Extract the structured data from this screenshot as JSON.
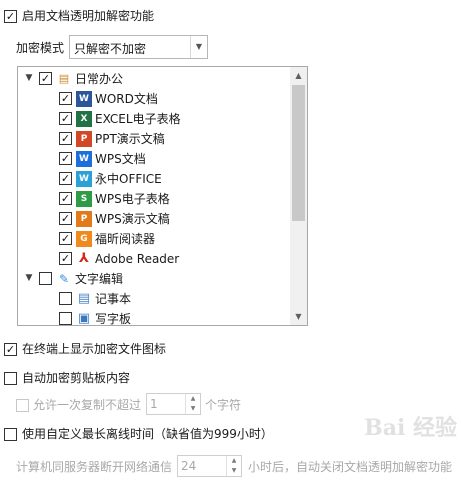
{
  "enable_transparent": {
    "label": "启用文档透明加解密功能",
    "checked": true
  },
  "mode": {
    "label": "加密模式",
    "value": "只解密不加密"
  },
  "tree": {
    "groups": [
      {
        "label": "日常办公",
        "checked": true,
        "expanded": true,
        "items": [
          {
            "label": "WORD文档",
            "checked": true,
            "icon": "word-icon",
            "color": "#2b579a",
            "glyph": "W"
          },
          {
            "label": "EXCEL电子表格",
            "checked": true,
            "icon": "excel-icon",
            "color": "#217346",
            "glyph": "X"
          },
          {
            "label": "PPT演示文稿",
            "checked": true,
            "icon": "ppt-icon",
            "color": "#d24726",
            "glyph": "P"
          },
          {
            "label": "WPS文档",
            "checked": true,
            "icon": "wps-writer-icon",
            "color": "#1e6fd9",
            "glyph": "W"
          },
          {
            "label": "永中OFFICE",
            "checked": true,
            "icon": "yozo-office-icon",
            "color": "#2aa2d8",
            "glyph": "W"
          },
          {
            "label": "WPS电子表格",
            "checked": true,
            "icon": "wps-spreadsheet-icon",
            "color": "#2e9b46",
            "glyph": "S"
          },
          {
            "label": "WPS演示文稿",
            "checked": true,
            "icon": "wps-presentation-icon",
            "color": "#e07a1a",
            "glyph": "P"
          },
          {
            "label": "福昕阅读器",
            "checked": true,
            "icon": "foxit-reader-icon",
            "color": "#f08a1c",
            "glyph": "G"
          },
          {
            "label": "Adobe Reader",
            "checked": true,
            "icon": "adobe-reader-icon",
            "color": "#d4261e",
            "glyph": "A"
          }
        ]
      },
      {
        "label": "文字编辑",
        "checked": false,
        "expanded": true,
        "items": [
          {
            "label": "记事本",
            "checked": false,
            "icon": "notepad-icon",
            "color": "#6aa5d8",
            "glyph": ""
          },
          {
            "label": "写字板",
            "checked": false,
            "icon": "wordpad-icon",
            "color": "#3a78c0",
            "glyph": ""
          }
        ]
      }
    ]
  },
  "show_icon": {
    "label": "在终端上显示加密文件图标",
    "checked": true
  },
  "auto_clipboard": {
    "label": "自动加密剪贴板内容",
    "checked": false
  },
  "allow_copy": {
    "label": "允许一次复制不超过",
    "value": "1",
    "unit": "个字符",
    "checked": false
  },
  "custom_offline": {
    "label": "使用自定义最长离线时间（缺省值为999小时）",
    "checked": false
  },
  "offline": {
    "prefix": "计算机同服务器断开网络通信",
    "value": "24",
    "suffix": "小时后，自动关闭文档透明加解密功能"
  },
  "watermark": "Bai 经验"
}
